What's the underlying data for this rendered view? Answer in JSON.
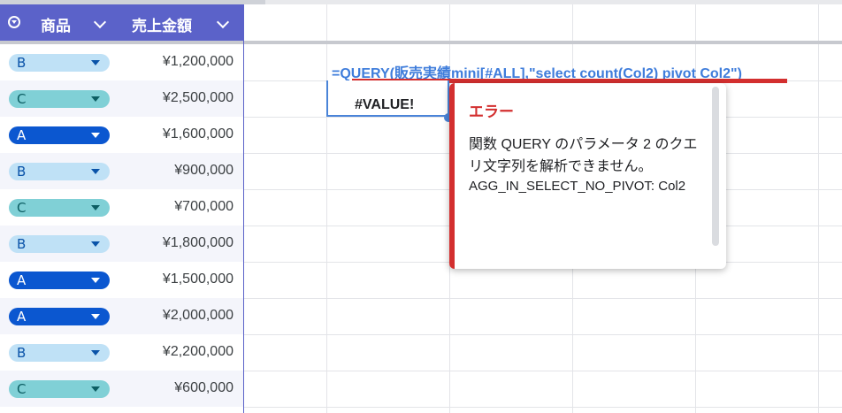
{
  "table": {
    "headers": [
      "商品",
      "売上金額"
    ],
    "rows": [
      {
        "product": "B",
        "amount": "¥1,200,000"
      },
      {
        "product": "C",
        "amount": "¥2,500,000"
      },
      {
        "product": "A",
        "amount": "¥1,600,000"
      },
      {
        "product": "B",
        "amount": "¥900,000"
      },
      {
        "product": "C",
        "amount": "¥700,000"
      },
      {
        "product": "B",
        "amount": "¥1,800,000"
      },
      {
        "product": "A",
        "amount": "¥1,500,000"
      },
      {
        "product": "A",
        "amount": "¥2,000,000"
      },
      {
        "product": "B",
        "amount": "¥2,200,000"
      },
      {
        "product": "C",
        "amount": "¥600,000"
      }
    ]
  },
  "chip_colors": {
    "A": {
      "bg": "#0b57d0",
      "fg": "#ffffff"
    },
    "B": {
      "bg": "#bfe1f6",
      "fg": "#0a53a8"
    },
    "C": {
      "bg": "#80d0d6",
      "fg": "#0c5e63"
    }
  },
  "cell": {
    "formula": "=QUERY(販売実績mini[#ALL],\"select count(Col2) pivot Col2\")",
    "value": "#VALUE!"
  },
  "error_popup": {
    "title": "エラー",
    "message": "関数 QUERY のパラメータ 2 のクエリ文字列を解析できません。",
    "code": "AGG_IN_SELECT_NO_PIVOT: Col2"
  }
}
